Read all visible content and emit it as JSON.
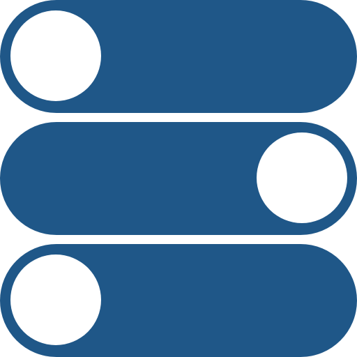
{
  "colors": {
    "track": "#1f5788",
    "knob": "#ffffff"
  },
  "toggles": [
    {
      "name": "toggle-1",
      "state": "off"
    },
    {
      "name": "toggle-2",
      "state": "on"
    },
    {
      "name": "toggle-3",
      "state": "off"
    }
  ]
}
